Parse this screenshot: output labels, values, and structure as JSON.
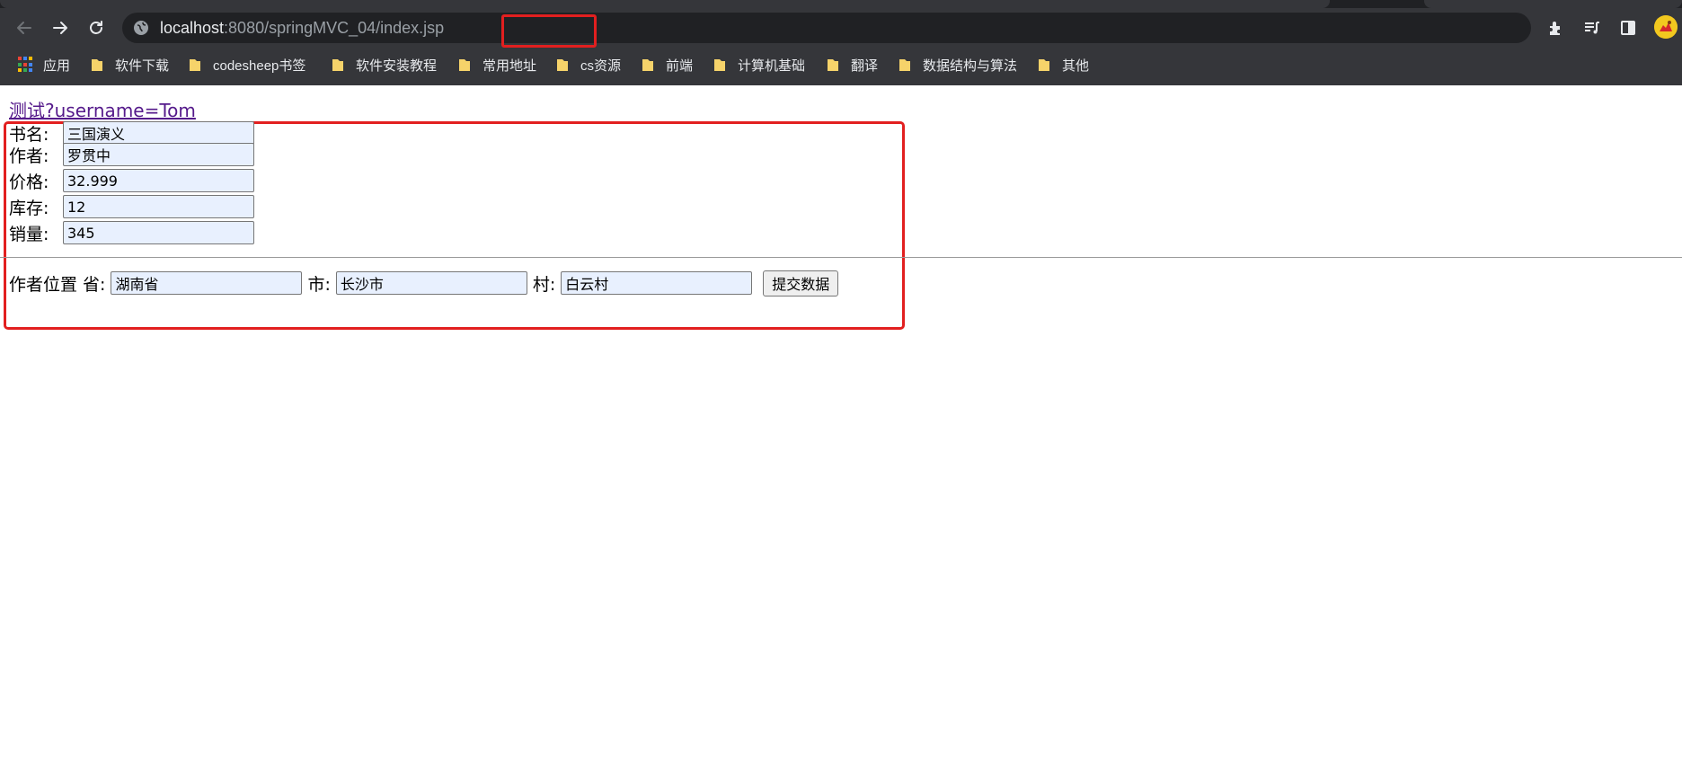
{
  "browser": {
    "url_host": "localhost",
    "url_rest": ":8080/springMVC_04/index.jsp",
    "bookmarks": [
      {
        "label": "应用",
        "type": "apps"
      },
      {
        "label": "软件下载",
        "type": "folder"
      },
      {
        "label": "codesheep书签",
        "type": "folder"
      },
      {
        "label": "软件安装教程",
        "type": "folder"
      },
      {
        "label": "常用地址",
        "type": "folder"
      },
      {
        "label": "cs资源",
        "type": "folder"
      },
      {
        "label": "前端",
        "type": "folder"
      },
      {
        "label": "计算机基础",
        "type": "folder"
      },
      {
        "label": "翻译",
        "type": "folder"
      },
      {
        "label": "数据结构与算法",
        "type": "folder"
      },
      {
        "label": "其他",
        "type": "folder"
      }
    ],
    "icons": [
      "back-arrow-icon",
      "forward-arrow-icon",
      "reload-icon",
      "site-info-icon",
      "extensions-icon",
      "reading-list-icon",
      "side-panel-icon",
      "avatar"
    ]
  },
  "page": {
    "test_link": "测试?username=Tom",
    "book": {
      "fields": [
        {
          "label": "书名:",
          "value": "三国演义"
        },
        {
          "label": "作者:",
          "value": "罗贯中"
        },
        {
          "label": "价格:",
          "value": "32.999"
        },
        {
          "label": "库存:",
          "value": "12"
        },
        {
          "label": "销量:",
          "value": "345"
        }
      ]
    },
    "location": {
      "label": "作者位置 省:",
      "province_value": "湖南省",
      "city_label": "市:",
      "city_value": "长沙市",
      "village_label": "村:",
      "village_value": "白云村",
      "submit_label": "提交数据"
    }
  },
  "colors": {
    "annotation_red": "#e21f1f",
    "chrome_bg": "#35363a",
    "autofill_bg": "#e8f0fe",
    "visited_link": "#551a8b"
  }
}
